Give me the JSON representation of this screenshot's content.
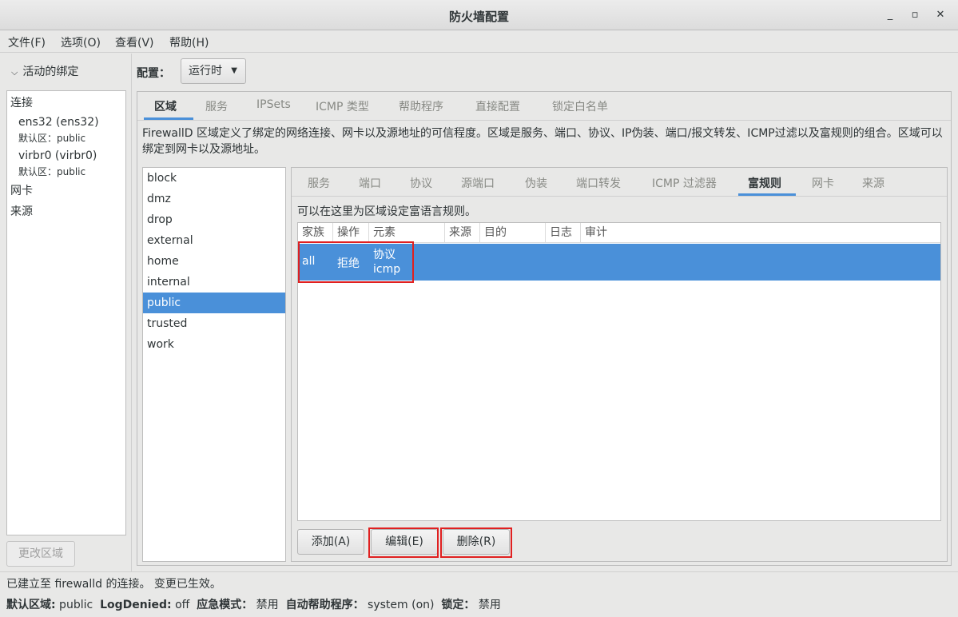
{
  "window": {
    "title": "防火墙配置",
    "minimize": "_",
    "maximize": "▫",
    "close": "✕"
  },
  "menu": [
    "文件(F)",
    "选项(O)",
    "查看(V)",
    "帮助(H)"
  ],
  "sidebar": {
    "expander_label": "活动的绑定",
    "connections_header": "连接",
    "connections": [
      {
        "name": "ens32 (ens32)",
        "zone": "默认区：public"
      },
      {
        "name": "virbr0 (virbr0)",
        "zone": "默认区：public"
      }
    ],
    "interfaces_header": "网卡",
    "sources_header": "来源",
    "change_zone_button": "更改区域"
  },
  "config": {
    "label": "配置：",
    "mode": "运行时"
  },
  "top_tabs": [
    "区域",
    "服务",
    "IPSets",
    "ICMP 类型",
    "帮助程序",
    "直接配置",
    "锁定白名单"
  ],
  "zone_description": "FirewallD 区域定义了绑定的网络连接、网卡以及源地址的可信程度。区域是服务、端口、协议、IP伪装、端口/报文转发、ICMP过滤以及富规则的组合。区域可以绑定到网卡以及源地址。",
  "zones": [
    "block",
    "dmz",
    "drop",
    "external",
    "home",
    "internal",
    "public",
    "trusted",
    "work"
  ],
  "selected_zone": "public",
  "zone_tabs": [
    "服务",
    "端口",
    "协议",
    "源端口",
    "伪装",
    "端口转发",
    "ICMP 过滤器",
    "富规则",
    "网卡",
    "来源"
  ],
  "rich_rules": {
    "hint": "可以在这里为区域设定富语言规则。",
    "columns": [
      "家族",
      "操作",
      "元素",
      "来源",
      "目的",
      "日志",
      "审计"
    ],
    "rows": [
      {
        "family": "all",
        "action": "拒绝",
        "element_line1": "协议",
        "element_line2": "icmp"
      }
    ],
    "add_button": "添加(A)",
    "edit_button": "编辑(E)",
    "delete_button": "删除(R)"
  },
  "status": {
    "connection_text": "已建立至  firewalld 的连接。 变更已生效。",
    "default_zone_label": "默认区域:",
    "default_zone_value": " public",
    "logdenied_label": "LogDenied:",
    "logdenied_value": " off",
    "panic_label": "应急模式：",
    "panic_value": " 禁用",
    "autohelper_label": "自动帮助程序：",
    "autohelper_value": " system (on)",
    "lockdown_label": "锁定：",
    "lockdown_value": " 禁用"
  },
  "colors": {
    "accent": "#4a90d9",
    "highlight_box": "#e02020"
  }
}
